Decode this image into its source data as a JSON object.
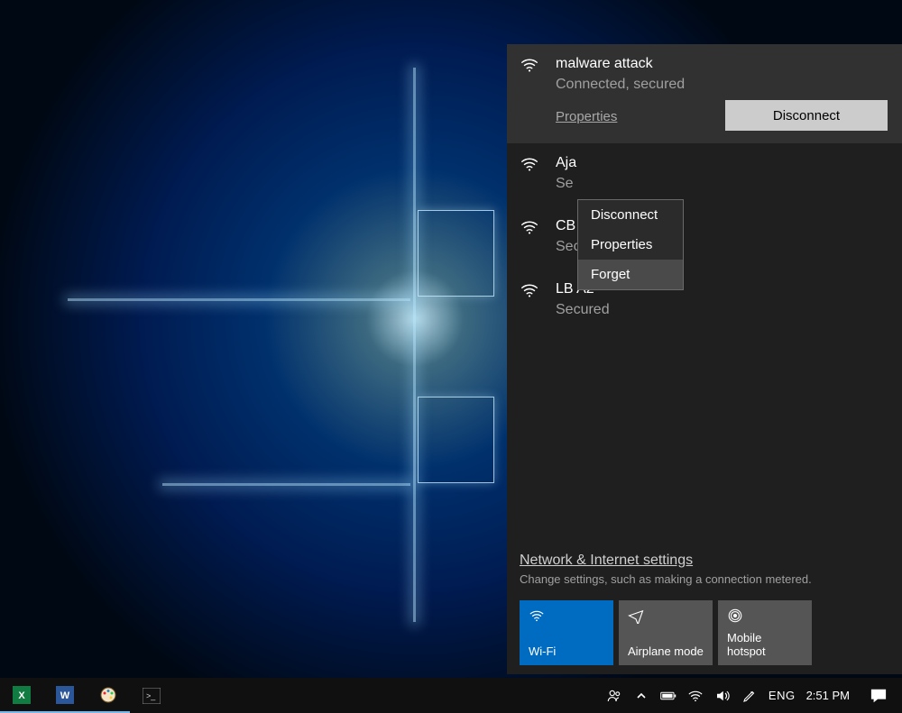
{
  "networks": {
    "connected": {
      "name": "malware attack",
      "status": "Connected, secured",
      "properties": "Properties",
      "disconnect": "Disconnect"
    },
    "others": [
      {
        "name": "Aja",
        "status": "Se"
      },
      {
        "name": "CB",
        "status": "Secured"
      },
      {
        "name": "LB A2",
        "status": "Secured"
      }
    ]
  },
  "context_menu": {
    "items": [
      "Disconnect",
      "Properties",
      "Forget"
    ],
    "hovered": 2
  },
  "bottom": {
    "link": "Network & Internet settings",
    "desc": "Change settings, such as making a connection metered.",
    "tiles": [
      {
        "label": "Wi-Fi",
        "active": true,
        "icon": "wifi"
      },
      {
        "label": "Airplane mode",
        "active": false,
        "icon": "plane"
      },
      {
        "label": "Mobile hotspot",
        "active": false,
        "icon": "hotspot"
      }
    ]
  },
  "taskbar": {
    "apps": [
      "excel",
      "word",
      "paint",
      "cmd"
    ],
    "tray": {
      "lang": "ENG",
      "time": "2:51 PM"
    }
  }
}
